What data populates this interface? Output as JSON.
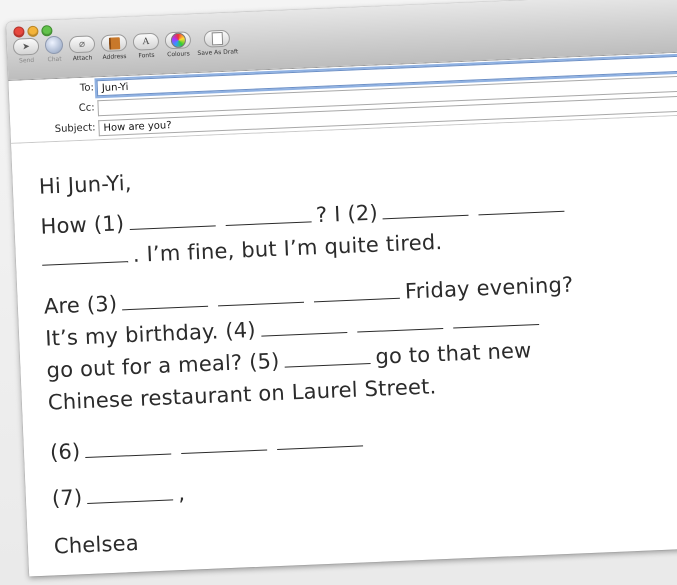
{
  "toolbar": {
    "items": [
      {
        "label": "Send",
        "icon": "paper-plane-icon",
        "disabled": true
      },
      {
        "label": "Chat",
        "icon": "chat-bubble-icon",
        "disabled": true
      },
      {
        "label": "Attach",
        "icon": "paperclip-icon",
        "disabled": false
      },
      {
        "label": "Address",
        "icon": "address-book-icon",
        "disabled": false
      },
      {
        "label": "Fonts",
        "icon": "fonts-icon",
        "disabled": false
      },
      {
        "label": "Colours",
        "icon": "color-wheel-icon",
        "disabled": false
      },
      {
        "label": "Save As Draft",
        "icon": "draft-icon",
        "disabled": false
      }
    ]
  },
  "headers": {
    "to_label": "To:",
    "to_value": "Jun-Yi",
    "cc_label": "Cc:",
    "cc_value": "",
    "subject_label": "Subject:",
    "subject_value": "How are you?"
  },
  "message": {
    "greeting": "Hi Jun-Yi,",
    "l1_a": "How (1)",
    "l1_b": "? I (2)",
    "l2_b": ". I’m fine, but I’m quite tired.",
    "l3_a": "Are (3)",
    "l3_b": "Friday evening?",
    "l4_a": "It’s my birthday. (4)",
    "l5_a": "go out for a meal? (5)",
    "l5_b": "go to that new",
    "l6": "Chinese restaurant on Laurel Street.",
    "l7_a": "(6)",
    "l8_a": "(7)",
    "l8_b": ",",
    "signature": "Chelsea"
  },
  "colors": {
    "focus_ring": "#8fb1e2",
    "close": "#e8483e",
    "minimize": "#f4b43a",
    "maximize": "#62c34b"
  }
}
